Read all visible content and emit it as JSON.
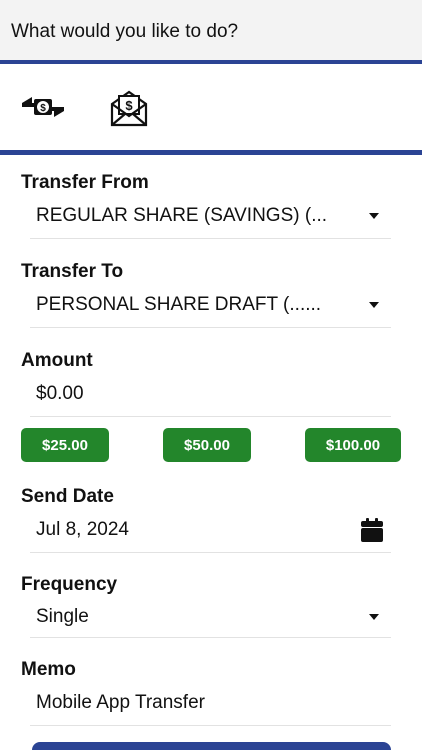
{
  "header": {
    "prompt": "What would you like to do?"
  },
  "actions": [
    {
      "icon": "money-transfer-icon"
    },
    {
      "icon": "envelope-dollar-icon"
    }
  ],
  "transfer_from": {
    "label": "Transfer From",
    "value": "REGULAR SHARE (SAVINGS) (..."
  },
  "transfer_to": {
    "label": "Transfer To",
    "value": "PERSONAL SHARE DRAFT (......"
  },
  "amount": {
    "label": "Amount",
    "value": "$0.00",
    "quick": [
      "$25.00",
      "$50.00",
      "$100.00"
    ]
  },
  "send_date": {
    "label": "Send Date",
    "value": "Jul 8, 2024",
    "icon": "calendar-icon"
  },
  "frequency": {
    "label": "Frequency",
    "value": "Single"
  },
  "memo": {
    "label": "Memo",
    "value": "Mobile App Transfer"
  },
  "colors": {
    "brand": "#2b4494",
    "quick_button": "#23862b",
    "header_bg": "#f3f3f3"
  }
}
